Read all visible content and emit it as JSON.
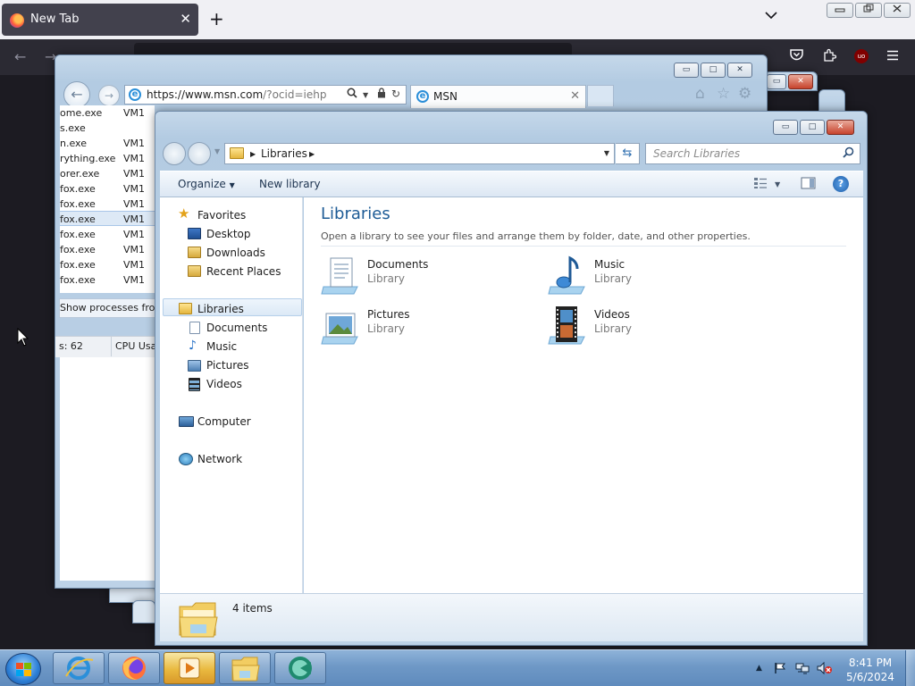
{
  "firefox": {
    "tab_title": "New Tab",
    "tab_close": "✕",
    "new_tab": "+",
    "list_all_tabs": "⌄",
    "win_minimize": "▭",
    "win_restore": "⧉",
    "win_close": "✕",
    "ublock_label": "uo"
  },
  "taskmgr": {
    "processes": [
      {
        "name": "ome.exe",
        "user": "VM1"
      },
      {
        "name": "s.exe",
        "user": ""
      },
      {
        "name": "n.exe",
        "user": "VM1"
      },
      {
        "name": "rything.exe",
        "user": "VM1"
      },
      {
        "name": "orer.exe",
        "user": "VM1"
      },
      {
        "name": "fox.exe",
        "user": "VM1"
      },
      {
        "name": "fox.exe",
        "user": "VM1"
      },
      {
        "name": "fox.exe",
        "user": "VM1"
      },
      {
        "name": "fox.exe",
        "user": "VM1"
      },
      {
        "name": "fox.exe",
        "user": "VM1"
      },
      {
        "name": "fox.exe",
        "user": "VM1"
      },
      {
        "name": "fox.exe",
        "user": "VM1"
      }
    ],
    "selected_index": 7,
    "show_processes_button": "Show processes from",
    "status_processes": "s: 62",
    "status_cpu": "CPU Usa"
  },
  "ie": {
    "url_domain": "https://www.msn.com",
    "url_rest": "/?ocid=iehp",
    "tab_title": "MSN",
    "tab_close": "✕"
  },
  "explorer": {
    "breadcrumb": "Libraries",
    "search_placeholder": "Search Libraries",
    "toolbar": {
      "organize": "Organize",
      "new_library": "New library"
    },
    "nav": {
      "favorites": "Favorites",
      "favorites_items": [
        "Desktop",
        "Downloads",
        "Recent Places"
      ],
      "libraries": "Libraries",
      "libraries_items": [
        "Documents",
        "Music",
        "Pictures",
        "Videos"
      ],
      "computer": "Computer",
      "network": "Network"
    },
    "content": {
      "title": "Libraries",
      "subtitle": "Open a library to see your files and arrange them by folder, date, and other properties.",
      "libraries": [
        {
          "name": "Documents",
          "kind": "Library",
          "icon": "documents-library-icon"
        },
        {
          "name": "Music",
          "kind": "Library",
          "icon": "music-library-icon"
        },
        {
          "name": "Pictures",
          "kind": "Library",
          "icon": "pictures-library-icon"
        },
        {
          "name": "Videos",
          "kind": "Library",
          "icon": "videos-library-icon"
        }
      ]
    },
    "details": {
      "count": "4 items"
    }
  },
  "taskbar": {
    "apps": [
      "internet-explorer-icon",
      "firefox-icon",
      "media-player-icon",
      "windows-explorer-icon",
      "ccleaner-icon"
    ],
    "active_app": "media-player-icon",
    "clock_time": "8:41 PM",
    "clock_date": "5/6/2024"
  },
  "colors": {
    "aero_frame": "#b8cfe6",
    "content_title": "#1e5c96",
    "taskbar": "#6e98c6",
    "close_button": "#c7432c"
  }
}
